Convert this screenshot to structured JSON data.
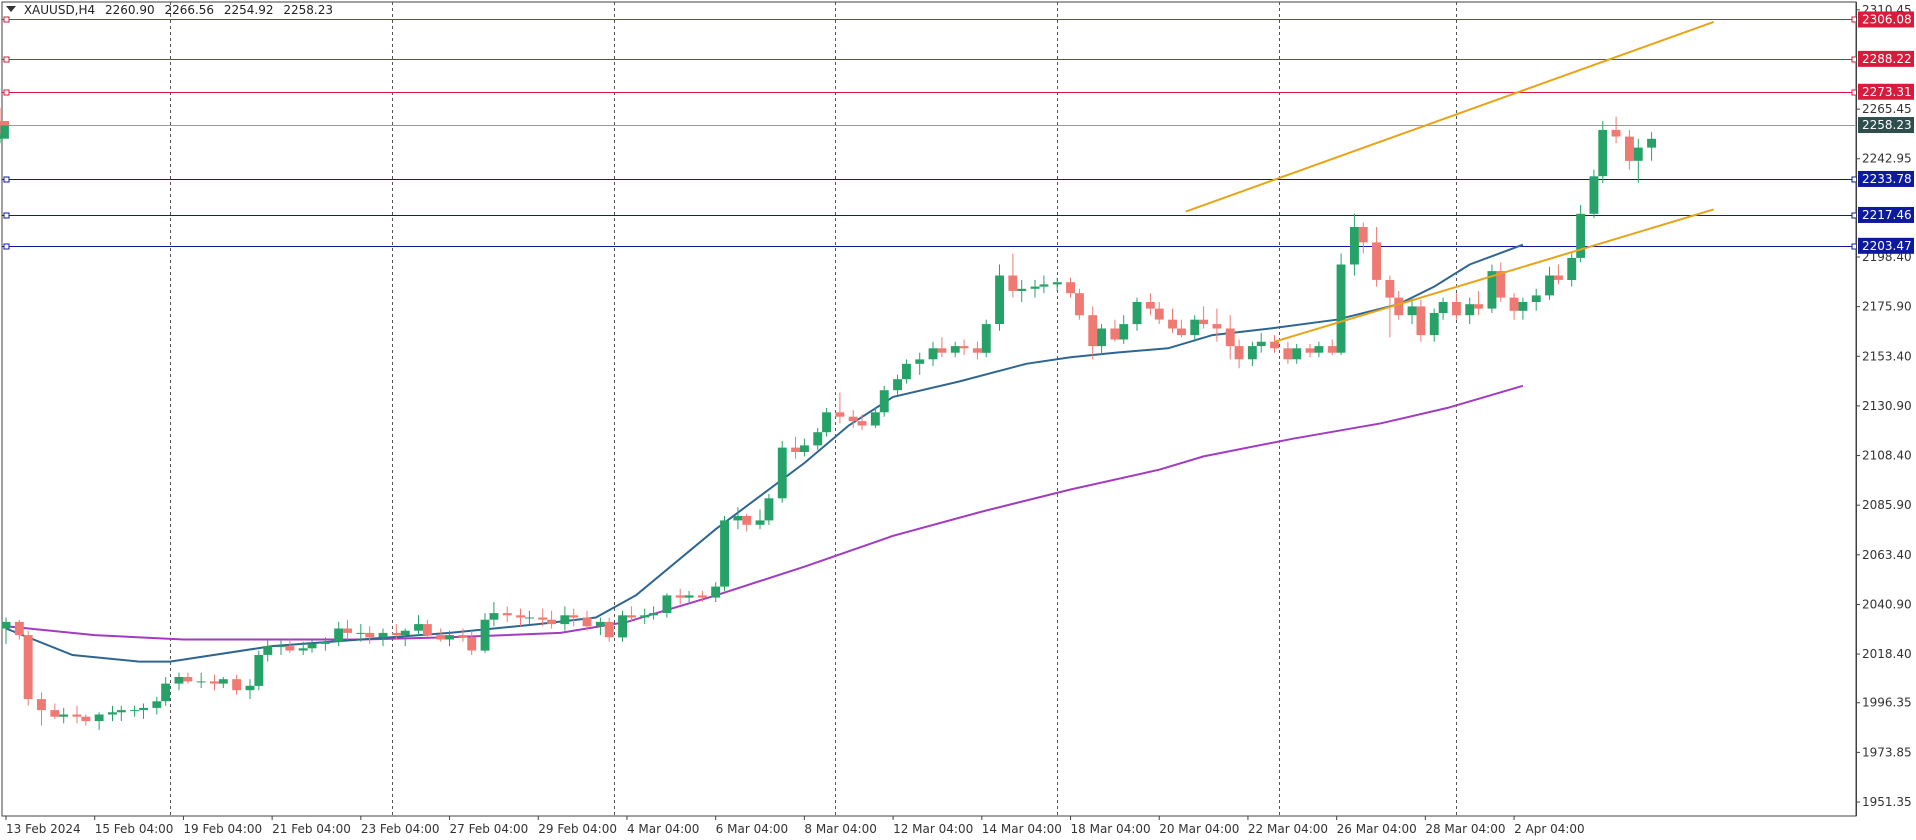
{
  "header": {
    "symbol": "XAUUSD,H4",
    "open": "2260.90",
    "high": "2266.56",
    "low": "2254.92",
    "close": "2258.23"
  },
  "colors": {
    "bull": "#26a269",
    "bear": "#ef7a73",
    "ma_fast": "#2f6690",
    "ma_slow": "#a23bc1",
    "channel": "#e8a317",
    "resistance": "#d81b3c",
    "support": "#0d1a9e",
    "current": "#2f4f4f"
  },
  "chart_data": {
    "type": "candlestick",
    "title": "",
    "xlabel": "",
    "ylabel": "",
    "ylim": [
      1945,
      2314
    ],
    "x_range": [
      0,
      372
    ],
    "y_ticks": [
      "2310.45",
      "2265.45",
      "2242.95",
      "2198.40",
      "2175.90",
      "2153.40",
      "2130.90",
      "2108.40",
      "2085.90",
      "2063.40",
      "2040.90",
      "2018.40",
      "1996.35",
      "1973.85",
      "1951.35"
    ],
    "x_ticks": [
      {
        "label": "13 Feb 2024",
        "i": 0
      },
      {
        "label": "15 Feb 04:00",
        "i": 20
      },
      {
        "label": "19 Feb 04:00",
        "i": 40
      },
      {
        "label": "21 Feb 04:00",
        "i": 60
      },
      {
        "label": "23 Feb 04:00",
        "i": 80
      },
      {
        "label": "27 Feb 04:00",
        "i": 100
      },
      {
        "label": "29 Feb 04:00",
        "i": 120
      },
      {
        "label": "4 Mar 04:00",
        "i": 140
      },
      {
        "label": "6 Mar 04:00",
        "i": 160
      },
      {
        "label": "8 Mar 04:00",
        "i": 180
      },
      {
        "label": "12 Mar 04:00",
        "i": 200
      },
      {
        "label": "14 Mar 04:00",
        "i": 220
      },
      {
        "label": "18 Mar 04:00",
        "i": 240
      },
      {
        "label": "20 Mar 04:00",
        "i": 260
      },
      {
        "label": "22 Mar 04:00",
        "i": 280
      },
      {
        "label": "26 Mar 04:00",
        "i": 300
      },
      {
        "label": "28 Mar 04:00",
        "i": 320
      },
      {
        "label": "2 Apr 04:00",
        "i": 340
      }
    ],
    "period_separators": [
      37,
      87,
      137,
      187,
      237,
      287,
      327
    ],
    "horizontal_levels": [
      {
        "value": 2306.08,
        "label": "2306.08",
        "kind": "resistance"
      },
      {
        "value": 2288.22,
        "label": "2288.22",
        "kind": "resistance"
      },
      {
        "value": 2273.31,
        "label": "2273.31",
        "kind": "resistance"
      },
      {
        "value": 2258.23,
        "label": "2258.23",
        "kind": "current"
      },
      {
        "value": 2233.78,
        "label": "2233.78",
        "kind": "support"
      },
      {
        "value": 2217.46,
        "label": "2217.46",
        "kind": "support"
      },
      {
        "value": 2203.47,
        "label": "2203.47",
        "kind": "support"
      }
    ],
    "trend_lines": [
      {
        "x1": 266,
        "y1": 2219,
        "x2": 385,
        "y2": 2305
      },
      {
        "x1": 286,
        "y1": 2160,
        "x2": 385,
        "y2": 2220
      }
    ],
    "ma_fast": [
      [
        0,
        2030
      ],
      [
        15,
        2018
      ],
      [
        30,
        2015
      ],
      [
        37,
        2015
      ],
      [
        60,
        2022
      ],
      [
        80,
        2025
      ],
      [
        100,
        2028
      ],
      [
        120,
        2032
      ],
      [
        133,
        2035
      ],
      [
        142,
        2045
      ],
      [
        160,
        2075
      ],
      [
        180,
        2105
      ],
      [
        190,
        2122
      ],
      [
        200,
        2135
      ],
      [
        215,
        2142
      ],
      [
        230,
        2150
      ],
      [
        240,
        2153
      ],
      [
        250,
        2155
      ],
      [
        262,
        2157
      ],
      [
        272,
        2163
      ],
      [
        285,
        2166
      ],
      [
        300,
        2170
      ],
      [
        314,
        2177
      ],
      [
        322,
        2185
      ],
      [
        330,
        2195
      ],
      [
        342,
        2204
      ]
    ],
    "ma_slow": [
      [
        0,
        2031
      ],
      [
        20,
        2027
      ],
      [
        40,
        2025
      ],
      [
        60,
        2025
      ],
      [
        80,
        2025
      ],
      [
        100,
        2026
      ],
      [
        125,
        2028
      ],
      [
        140,
        2033
      ],
      [
        160,
        2045
      ],
      [
        180,
        2058
      ],
      [
        200,
        2072
      ],
      [
        220,
        2083
      ],
      [
        240,
        2093
      ],
      [
        260,
        2102
      ],
      [
        270,
        2108
      ],
      [
        290,
        2116
      ],
      [
        310,
        2123
      ],
      [
        325,
        2130
      ],
      [
        342,
        2140
      ]
    ],
    "candles": [
      [
        2030,
        2035,
        2023,
        2033
      ],
      [
        2033,
        2034,
        2025,
        2027
      ],
      [
        2027,
        2029,
        1995,
        1998
      ],
      [
        1998,
        2001,
        1986,
        1993
      ],
      [
        1993,
        1996,
        1989,
        1990
      ],
      [
        1990,
        1994,
        1987,
        1991
      ],
      [
        1991,
        1995,
        1987,
        1990
      ],
      [
        1990,
        1991,
        1986,
        1988
      ],
      [
        1988,
        1992,
        1984,
        1991
      ],
      [
        1991,
        1995,
        1988,
        1992
      ],
      [
        1992,
        1995,
        1988,
        1993
      ],
      [
        1993,
        1995,
        1990,
        1993
      ],
      [
        1993,
        1996,
        1989,
        1994
      ],
      [
        1994,
        1999,
        1991,
        1997
      ],
      [
        1997,
        2008,
        1995,
        2005
      ],
      [
        2005,
        2010,
        2002,
        2008
      ],
      [
        2008,
        2010,
        2005,
        2006
      ],
      [
        2006,
        2010,
        2003,
        2006
      ],
      [
        2006,
        2009,
        2002,
        2005
      ],
      [
        2005,
        2008,
        2003,
        2007
      ],
      [
        2007,
        2009,
        2000,
        2002
      ],
      [
        2002,
        2007,
        1998,
        2004
      ],
      [
        2004,
        2020,
        2002,
        2018
      ],
      [
        2018,
        2025,
        2015,
        2022
      ],
      [
        2022,
        2025,
        2018,
        2022
      ],
      [
        2022,
        2025,
        2019,
        2020
      ],
      [
        2020,
        2024,
        2018,
        2021
      ],
      [
        2021,
        2025,
        2019,
        2023
      ],
      [
        2023,
        2026,
        2020,
        2024
      ],
      [
        2024,
        2033,
        2022,
        2030
      ],
      [
        2030,
        2034,
        2025,
        2028
      ],
      [
        2028,
        2032,
        2024,
        2028
      ],
      [
        2028,
        2031,
        2023,
        2026
      ],
      [
        2026,
        2030,
        2022,
        2028
      ],
      [
        2028,
        2032,
        2025,
        2027
      ],
      [
        2027,
        2030,
        2022,
        2029
      ],
      [
        2029,
        2036,
        2027,
        2032
      ],
      [
        2032,
        2034,
        2026,
        2027
      ],
      [
        2027,
        2030,
        2024,
        2025
      ],
      [
        2025,
        2029,
        2022,
        2027
      ],
      [
        2027,
        2030,
        2024,
        2026
      ],
      [
        2026,
        2029,
        2018,
        2020
      ],
      [
        2020,
        2037,
        2019,
        2034
      ],
      [
        2034,
        2042,
        2031,
        2037
      ],
      [
        2037,
        2040,
        2033,
        2036
      ],
      [
        2036,
        2039,
        2031,
        2035
      ],
      [
        2035,
        2038,
        2032,
        2035
      ],
      [
        2035,
        2039,
        2031,
        2034
      ],
      [
        2034,
        2038,
        2030,
        2032
      ],
      [
        2032,
        2040,
        2029,
        2036
      ],
      [
        2036,
        2039,
        2031,
        2035
      ],
      [
        2035,
        2038,
        2029,
        2031
      ],
      [
        2031,
        2035,
        2027,
        2033
      ],
      [
        2033,
        2035,
        2024,
        2026
      ],
      [
        2026,
        2038,
        2024,
        2036
      ],
      [
        2036,
        2040,
        2033,
        2035
      ],
      [
        2035,
        2039,
        2032,
        2036
      ],
      [
        2036,
        2040,
        2034,
        2037
      ],
      [
        2037,
        2046,
        2035,
        2045
      ],
      [
        2045,
        2048,
        2041,
        2044
      ],
      [
        2044,
        2047,
        2042,
        2045
      ],
      [
        2045,
        2047,
        2042,
        2044
      ],
      [
        2044,
        2051,
        2042,
        2049
      ],
      [
        2049,
        2081,
        2047,
        2079
      ],
      [
        2079,
        2085,
        2075,
        2081
      ],
      [
        2081,
        2082,
        2074,
        2077
      ],
      [
        2077,
        2084,
        2075,
        2079
      ],
      [
        2079,
        2091,
        2077,
        2089
      ],
      [
        2089,
        2115,
        2087,
        2112
      ],
      [
        2112,
        2117,
        2107,
        2110
      ],
      [
        2110,
        2116,
        2108,
        2113
      ],
      [
        2113,
        2121,
        2111,
        2119
      ],
      [
        2119,
        2130,
        2117,
        2128
      ],
      [
        2128,
        2137,
        2123,
        2126
      ],
      [
        2126,
        2129,
        2121,
        2124
      ],
      [
        2124,
        2127,
        2120,
        2122
      ],
      [
        2122,
        2130,
        2121,
        2128
      ],
      [
        2128,
        2140,
        2126,
        2138
      ],
      [
        2138,
        2145,
        2136,
        2143
      ],
      [
        2143,
        2152,
        2141,
        2150
      ],
      [
        2150,
        2155,
        2145,
        2152
      ],
      [
        2152,
        2160,
        2149,
        2157
      ],
      [
        2157,
        2162,
        2153,
        2155
      ],
      [
        2155,
        2160,
        2153,
        2158
      ],
      [
        2158,
        2161,
        2154,
        2157
      ],
      [
        2157,
        2160,
        2152,
        2155
      ],
      [
        2155,
        2170,
        2153,
        2168
      ],
      [
        2168,
        2195,
        2165,
        2190
      ],
      [
        2190,
        2200,
        2180,
        2183
      ],
      [
        2183,
        2188,
        2178,
        2184
      ],
      [
        2184,
        2188,
        2180,
        2185
      ],
      [
        2185,
        2190,
        2182,
        2186
      ],
      [
        2186,
        2189,
        2183,
        2187
      ],
      [
        2187,
        2189,
        2180,
        2182
      ],
      [
        2182,
        2184,
        2170,
        2172
      ],
      [
        2172,
        2176,
        2152,
        2158
      ],
      [
        2158,
        2168,
        2154,
        2166
      ],
      [
        2166,
        2170,
        2160,
        2161
      ],
      [
        2161,
        2172,
        2159,
        2168
      ],
      [
        2168,
        2180,
        2165,
        2178
      ],
      [
        2178,
        2182,
        2172,
        2175
      ],
      [
        2175,
        2178,
        2168,
        2170
      ],
      [
        2170,
        2175,
        2164,
        2166
      ],
      [
        2166,
        2170,
        2162,
        2163
      ],
      [
        2163,
        2172,
        2160,
        2170
      ],
      [
        2170,
        2176,
        2166,
        2168
      ],
      [
        2168,
        2175,
        2160,
        2166
      ],
      [
        2166,
        2172,
        2152,
        2158
      ],
      [
        2158,
        2161,
        2148,
        2152
      ],
      [
        2152,
        2160,
        2149,
        2158
      ],
      [
        2158,
        2164,
        2155,
        2160
      ],
      [
        2160,
        2163,
        2155,
        2157
      ],
      [
        2157,
        2160,
        2150,
        2152
      ],
      [
        2152,
        2159,
        2150,
        2157
      ],
      [
        2157,
        2159,
        2153,
        2155
      ],
      [
        2155,
        2160,
        2153,
        2158
      ],
      [
        2158,
        2161,
        2154,
        2155
      ],
      [
        2155,
        2200,
        2154,
        2195
      ],
      [
        2195,
        2218,
        2190,
        2212
      ],
      [
        2212,
        2214,
        2200,
        2205
      ],
      [
        2205,
        2212,
        2185,
        2188
      ],
      [
        2188,
        2190,
        2162,
        2180
      ],
      [
        2180,
        2183,
        2170,
        2172
      ],
      [
        2172,
        2180,
        2168,
        2176
      ],
      [
        2176,
        2179,
        2160,
        2163
      ],
      [
        2163,
        2175,
        2160,
        2173
      ],
      [
        2173,
        2180,
        2170,
        2178
      ],
      [
        2178,
        2182,
        2170,
        2172
      ],
      [
        2172,
        2180,
        2168,
        2177
      ],
      [
        2177,
        2183,
        2172,
        2175
      ],
      [
        2175,
        2195,
        2173,
        2192
      ],
      [
        2192,
        2196,
        2178,
        2180
      ],
      [
        2180,
        2182,
        2170,
        2174
      ],
      [
        2174,
        2180,
        2170,
        2178
      ],
      [
        2178,
        2184,
        2174,
        2181
      ],
      [
        2181,
        2194,
        2179,
        2190
      ],
      [
        2190,
        2195,
        2186,
        2188
      ],
      [
        2188,
        2200,
        2185,
        2198
      ],
      [
        2198,
        2222,
        2196,
        2218
      ],
      [
        2218,
        2238,
        2216,
        2235
      ],
      [
        2235,
        2260,
        2232,
        2256
      ],
      [
        2256,
        2262,
        2250,
        2253
      ],
      [
        2253,
        2256,
        2238,
        2242
      ],
      [
        2242,
        2252,
        2232,
        2248
      ],
      [
        2248,
        2255,
        2242,
        2252
      ],
      [
        2252,
        2260,
        2250,
        2258
      ],
      [
        2258,
        2264,
        2255,
        2260
      ],
      [
        2260,
        2266,
        2254,
        2258
      ]
    ],
    "candle_x": [
      0,
      3,
      5,
      8,
      11,
      13,
      16,
      18,
      21,
      24,
      26,
      29,
      31,
      34,
      36,
      39,
      41,
      44,
      47,
      49,
      52,
      55,
      57,
      59,
      62,
      64,
      67,
      69,
      72,
      75,
      77,
      80,
      82,
      85,
      88,
      90,
      93,
      95,
      98,
      100,
      103,
      105,
      108,
      110,
      113,
      116,
      118,
      121,
      123,
      126,
      128,
      131,
      134,
      136,
      139,
      141,
      144,
      146,
      149,
      152,
      154,
      157,
      160,
      162,
      165,
      167,
      170,
      172,
      175,
      178,
      180,
      183,
      185,
      188,
      191,
      193,
      196,
      198,
      201,
      203,
      206,
      209,
      211,
      214,
      216,
      219,
      221,
      224,
      227,
      229,
      232,
      234,
      237,
      240,
      242,
      245,
      247,
      250,
      252,
      255,
      258,
      260,
      263,
      265,
      268,
      270,
      273,
      276,
      278,
      281,
      283,
      286,
      289,
      291,
      294,
      296,
      299,
      301,
      304,
      306,
      309,
      312,
      314,
      317,
      319,
      322,
      324,
      327,
      330,
      332,
      335,
      337,
      340,
      342,
      345,
      348,
      350,
      353,
      355,
      358,
      360,
      363,
      366,
      368,
      371
    ]
  }
}
